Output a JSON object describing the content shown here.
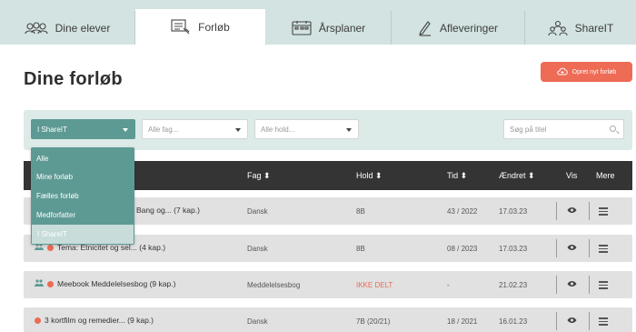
{
  "tabs": [
    {
      "label": "Dine elever",
      "icon": "students-icon"
    },
    {
      "label": "Forløb",
      "icon": "course-icon",
      "active": true
    },
    {
      "label": "Årsplaner",
      "icon": "calendar-icon"
    },
    {
      "label": "Afleveringer",
      "icon": "pen-icon"
    },
    {
      "label": "ShareIT",
      "icon": "share-people-icon"
    }
  ],
  "page_title": "Dine forløb",
  "new_button_label": "Opret nyt forløb",
  "filters": {
    "share_select": "I ShareIT",
    "subject_placeholder": "Alle fag...",
    "class_placeholder": "Alle hold...",
    "search_placeholder": "Søg på titel"
  },
  "dropdown_options": [
    "Alle",
    "Mine forløb",
    "Fælles forløb",
    "Medforfatter",
    "I ShareIT"
  ],
  "dropdown_selected": "I ShareIT",
  "columns": {
    "fag": "Fag ⬍",
    "hold": "Hold ⬍",
    "tid": "Tid ⬍",
    "aendret": "Ændret ⬍",
    "vis": "Vis",
    "mere": "Mere"
  },
  "rows": [
    {
      "title": "Bang og... (7 kap.)",
      "fag": "Dansk",
      "hold": "8B",
      "tid": "43 / 2022",
      "aendret": "17.03.23"
    },
    {
      "title": "Tema: Etnicitet og sel... (4 kap.)",
      "fag": "Dansk",
      "hold": "8B",
      "tid": "08 / 2023",
      "aendret": "17.03.23"
    },
    {
      "title": "Meebook Meddelelsesbog (9 kap.)",
      "fag": "Meddelelsesbog",
      "hold": "IKKE DELT",
      "tid": "-",
      "aendret": "21.02.23"
    },
    {
      "title": "3 kortfilm og remedier... (9 kap.)",
      "fag": "Dansk",
      "hold": "7B (20/21)",
      "tid": "18 / 2021",
      "aendret": "16.01.23"
    }
  ],
  "colors": {
    "accent": "#5e9a94",
    "brand_red": "#ee6b55",
    "header_dark": "#343434",
    "tabbar": "#d2e3e1"
  }
}
